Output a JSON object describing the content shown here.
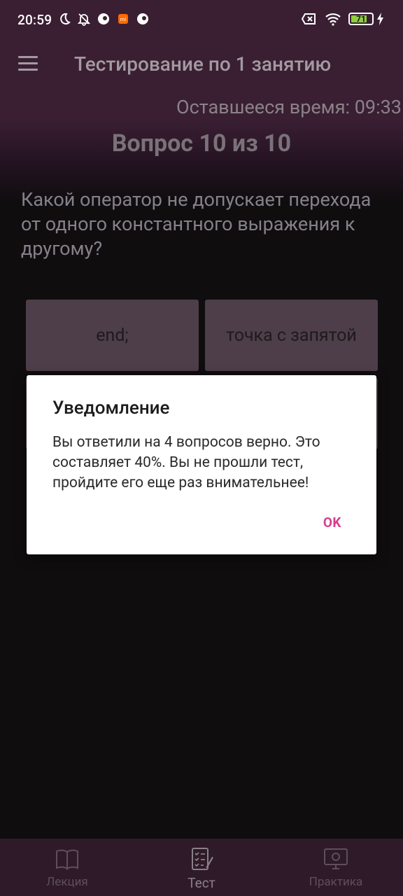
{
  "status_bar": {
    "time": "20:59",
    "battery": "71"
  },
  "toolbar": {
    "title": "Тестирование по 1 занятию"
  },
  "quiz": {
    "timer": "Оставшееся время: 09:33",
    "question_number": "Вопрос 10 из 10",
    "question_text": "Какой оператор не допускает перехода от одного константного выражения к другому?",
    "answers": [
      "end;",
      "точка с запятой",
      "",
      ""
    ]
  },
  "dialog": {
    "title": "Уведомление",
    "message": "Вы ответили на 4 вопросов верно. Это составляет 40%. Вы не прошли тест, пройдите его еще раз внимательнее!",
    "ok_label": "OK"
  },
  "bottom_nav": {
    "items": [
      {
        "label": "Лекция",
        "icon": "book-icon"
      },
      {
        "label": "Тест",
        "icon": "test-checklist-icon"
      },
      {
        "label": "Практика",
        "icon": "monitor-icon"
      }
    ],
    "active_index": 1
  },
  "colors": {
    "header_bg": "#3a1f33",
    "answer_bg": "#4d3e49",
    "accent": "#d63e8f",
    "nav_bg": "#2f1a29"
  }
}
